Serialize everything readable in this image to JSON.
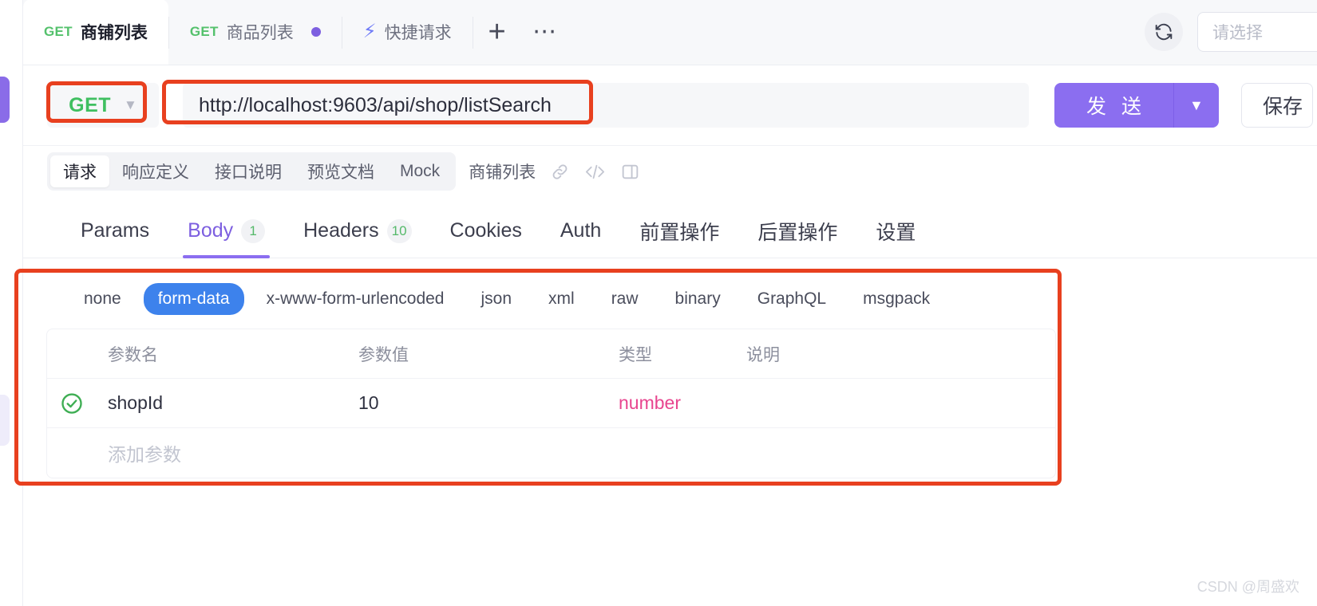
{
  "tabbar": {
    "tabs": [
      {
        "method": "GET",
        "name": "商铺列表",
        "active": true,
        "dirty": false
      },
      {
        "method": "GET",
        "name": "商品列表",
        "active": false,
        "dirty": true
      }
    ],
    "quick_request": {
      "label": "快捷请求",
      "icon": "bolt-icon"
    },
    "add_tab_label": "+",
    "more_label": "···",
    "refresh_icon": "refresh-icon",
    "env_select_placeholder": "请选择"
  },
  "urlbar": {
    "method": "GET",
    "url": "http://localhost:9603/api/shop/listSearch",
    "send_label": "发 送",
    "save_label": "保存"
  },
  "segment": {
    "items": [
      {
        "label": "请求",
        "active": true
      },
      {
        "label": "响应定义",
        "active": false
      },
      {
        "label": "接口说明",
        "active": false
      },
      {
        "label": "预览文档",
        "active": false
      },
      {
        "label": "Mock",
        "active": false
      }
    ],
    "api_name": "商铺列表",
    "icons": [
      "link-icon",
      "code-icon",
      "panel-icon"
    ]
  },
  "main_tabs": [
    {
      "label": "Params",
      "badge": null,
      "active": false
    },
    {
      "label": "Body",
      "badge": "1",
      "active": true
    },
    {
      "label": "Headers",
      "badge": "10",
      "active": false
    },
    {
      "label": "Cookies",
      "badge": null,
      "active": false
    },
    {
      "label": "Auth",
      "badge": null,
      "active": false
    },
    {
      "label": "前置操作",
      "badge": null,
      "active": false
    },
    {
      "label": "后置操作",
      "badge": null,
      "active": false
    },
    {
      "label": "设置",
      "badge": null,
      "active": false
    }
  ],
  "body_types": [
    {
      "label": "none",
      "active": false
    },
    {
      "label": "form-data",
      "active": true
    },
    {
      "label": "x-www-form-urlencoded",
      "active": false
    },
    {
      "label": "json",
      "active": false
    },
    {
      "label": "xml",
      "active": false
    },
    {
      "label": "raw",
      "active": false
    },
    {
      "label": "binary",
      "active": false
    },
    {
      "label": "GraphQL",
      "active": false
    },
    {
      "label": "msgpack",
      "active": false
    }
  ],
  "params_table": {
    "headers": {
      "name": "参数名",
      "value": "参数值",
      "type": "类型",
      "desc": "说明"
    },
    "rows": [
      {
        "checked": true,
        "name": "shopId",
        "value": "10",
        "type": "number",
        "desc": ""
      }
    ],
    "add_row_placeholder": "添加参数"
  },
  "colors": {
    "accent_purple": "#8b6ef0",
    "method_green": "#3fbf60",
    "form_data_blue": "#3d82ec",
    "type_pink": "#e8458f",
    "annotation_red": "#e8401f"
  },
  "watermark": "CSDN @周盛欢"
}
